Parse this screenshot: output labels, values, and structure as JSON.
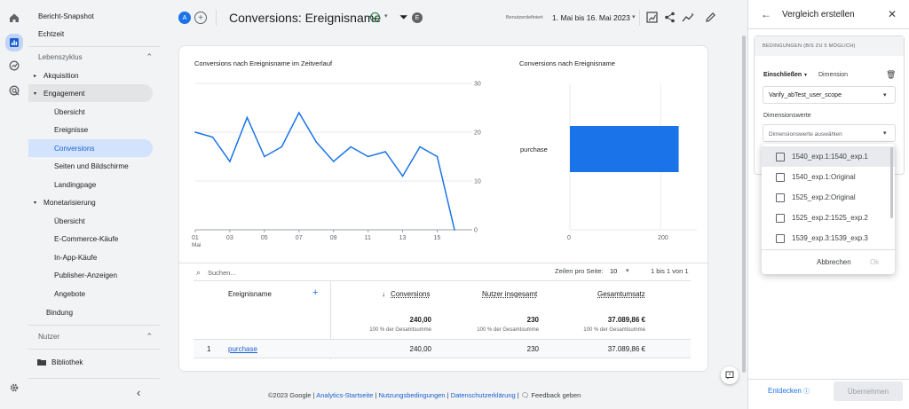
{
  "rail": {
    "icons": [
      "home-icon",
      "reports-icon",
      "explore-icon",
      "advertising-icon"
    ],
    "settings_icon": "gear-icon"
  },
  "nav": {
    "snapshot": "Bericht-Snapshot",
    "realtime": "Echtzeit",
    "lifecycle": "Lebenszyklus",
    "acquisition": "Akquisition",
    "engagement": "Engagement",
    "engagement_items": [
      "Übersicht",
      "Ereignisse",
      "Conversions",
      "Seiten und Bildschirme",
      "Landingpage"
    ],
    "monetization": "Monetarisierung",
    "monetization_items": [
      "Übersicht",
      "E-Commerce-Käufe",
      "In-App-Käufe",
      "Publisher-Anzeigen",
      "Angebote"
    ],
    "retention": "Bindung",
    "users": "Nutzer",
    "library": "Bibliothek"
  },
  "header": {
    "avatar": "A",
    "title": "Conversions: Ereignisname",
    "filter_badge": "E",
    "date_label": "Benutzerdefiniert",
    "date_range": "1. Mai bis 16. Mai 2023"
  },
  "card": {
    "line_title": "Conversions nach Ereignisname im Zeitverlauf",
    "bar_title": "Conversions nach Ereignisname",
    "search_placeholder": "Suchen...",
    "rows_per_page_label": "Zeilen pro Seite:",
    "rows_per_page": "10",
    "pagination": "1 bis 1 von 1",
    "columns": [
      "Ereignisname",
      "Conversions",
      "Nutzer insgesamt",
      "Gesamtumsatz"
    ],
    "totals": [
      "240,00",
      "230",
      "37.089,86 €"
    ],
    "totals_sub": [
      "100 % der Gesamtsumme",
      "100 % der Gesamtsumme",
      "100 % der Gesamtsumme"
    ],
    "rows": [
      {
        "index": "1",
        "name": "purchase",
        "conversions": "240,00",
        "users": "230",
        "revenue": "37.089,86 €"
      }
    ]
  },
  "chart_data": [
    {
      "type": "line",
      "title": "Conversions nach Ereignisname im Zeitverlauf",
      "x": [
        "01",
        "02",
        "03",
        "04",
        "05",
        "06",
        "07",
        "08",
        "09",
        "10",
        "11",
        "12",
        "13",
        "14",
        "15",
        "16"
      ],
      "x_month_label": "Mai",
      "x_tick_labels": [
        "01",
        "03",
        "05",
        "07",
        "09",
        "11",
        "13",
        "15"
      ],
      "y_ticks": [
        "0",
        "10",
        "20",
        "30"
      ],
      "ylim": [
        0,
        30
      ],
      "series": [
        {
          "values": [
            20,
            19,
            14,
            23,
            15,
            17,
            24,
            18,
            14,
            17,
            15,
            16,
            11,
            17,
            15,
            0
          ]
        }
      ]
    },
    {
      "type": "bar",
      "title": "Conversions nach Ereignisname",
      "categories": [
        "purchase"
      ],
      "values": [
        240
      ],
      "x_ticks": [
        "0",
        "200"
      ],
      "xlim": [
        0,
        280
      ],
      "color": "#1a73e8"
    }
  ],
  "footer": {
    "copyright": "©2023 Google |",
    "links": [
      "Analytics-Startseite",
      "Nutzungsbedingungen",
      "Datenschutzerklärung"
    ],
    "feedback": "Feedback geben"
  },
  "panel": {
    "title": "Vergleich erstellen",
    "conditions": "BEDINGUNGEN (BIS ZU 5 MÖGLICH)",
    "include": "Einschließen",
    "dimension": "Dimension",
    "dimension_value": "Varify_abTest_user_scope",
    "values_label": "Dimensionswerte",
    "values_placeholder": "Dimensionswerte auswählen",
    "options": [
      "1540_exp.1:1540_exp.1",
      "1540_exp.1:Original",
      "1525_exp.2:Original",
      "1525_exp.2:1525_exp.2",
      "1539_exp.3:1539_exp.3"
    ],
    "cancel": "Abbrechen",
    "ok": "Ok",
    "discover": "Entdecken",
    "apply": "Übernehmen"
  },
  "colors": {
    "accent": "#1a73e8",
    "selected_bg": "#d3e3fd"
  }
}
